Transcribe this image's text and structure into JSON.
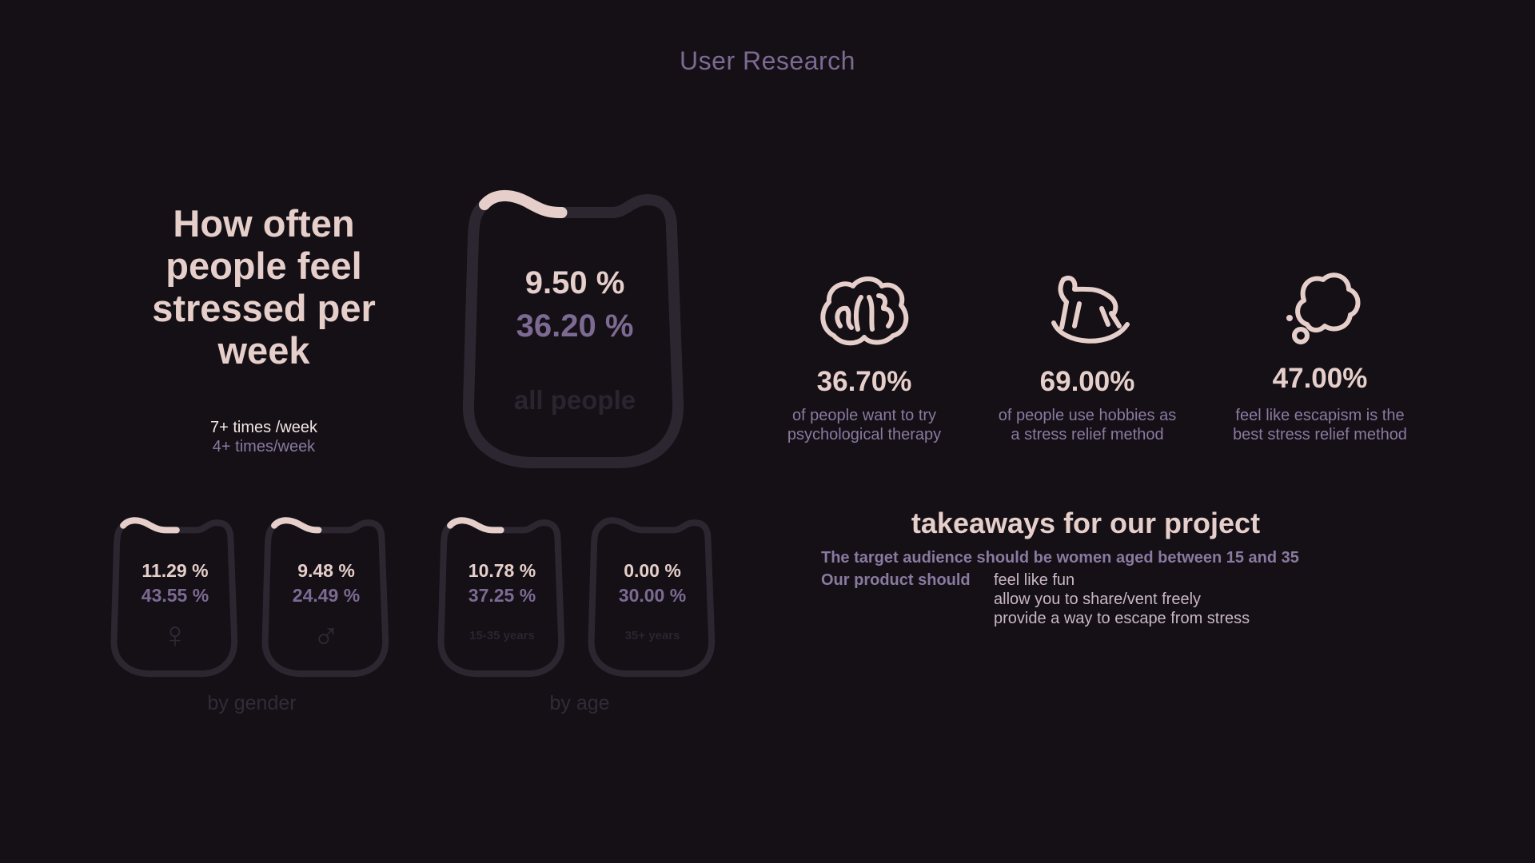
{
  "page": {
    "title": "User Research",
    "background": "#141016"
  },
  "headline": "How often people feel stressed per week",
  "legend": {
    "primary": "7+ times /week",
    "secondary": "4+ times/week"
  },
  "colors": {
    "primary": "#e6cfca",
    "secondary": "#7c6a93",
    "track": "#2c2631"
  },
  "chart_data": [
    {
      "type": "gauge",
      "series": [
        {
          "name": "7+ times /week",
          "values": [
            9.5
          ]
        },
        {
          "name": "4+ times/week",
          "values": [
            36.2
          ]
        }
      ],
      "categories": [
        "all people"
      ],
      "unit": "%"
    },
    {
      "type": "gauge",
      "title": "by gender",
      "categories": [
        "female",
        "male"
      ],
      "series": [
        {
          "name": "7+ times /week",
          "values": [
            11.29,
            9.48
          ]
        },
        {
          "name": "4+ times/week",
          "values": [
            43.55,
            24.49
          ]
        }
      ],
      "unit": "%"
    },
    {
      "type": "gauge",
      "title": "by age",
      "categories": [
        "15-35 years",
        "35+ years"
      ],
      "series": [
        {
          "name": "7+ times /week",
          "values": [
            10.78,
            0.0
          ]
        },
        {
          "name": "4+ times/week",
          "values": [
            37.25,
            30.0
          ]
        }
      ],
      "unit": "%"
    }
  ],
  "gauges": {
    "all": {
      "v1": "9.50 %",
      "v2": "36.20 %",
      "label": "all people"
    },
    "female": {
      "v1": "11.29 %",
      "v2": "43.55 %",
      "icon": "female-symbol-icon",
      "glyph": "♀"
    },
    "male": {
      "v1": "9.48 %",
      "v2": "24.49 %",
      "icon": "male-symbol-icon",
      "glyph": "♂"
    },
    "young": {
      "v1": "10.78 %",
      "v2": "37.25 %",
      "label": "15-35 years"
    },
    "old": {
      "v1": "0.00 %",
      "v2": "30.00 %",
      "label": "35+ years"
    }
  },
  "groups": {
    "gender": "by gender",
    "age": "by age"
  },
  "stats": [
    {
      "icon": "brain-icon",
      "value": "36.70%",
      "line1": "of people want to try",
      "line2": "psychological therapy"
    },
    {
      "icon": "rocking-horse-icon",
      "value": "69.00%",
      "line1": "of people use hobbies as",
      "line2": "a stress relief method"
    },
    {
      "icon": "cloud-bubble-icon",
      "value": "47.00%",
      "line1": "feel like escapism is the",
      "line2": "best stress relief method"
    }
  ],
  "takeaways": {
    "title": "takeaways for our project",
    "audience": "The target audience should be women aged between 15 and 35",
    "product_label": "Our product should",
    "items": [
      "feel like fun",
      "allow you to share/vent freely",
      "provide a way to escape from stress"
    ]
  }
}
